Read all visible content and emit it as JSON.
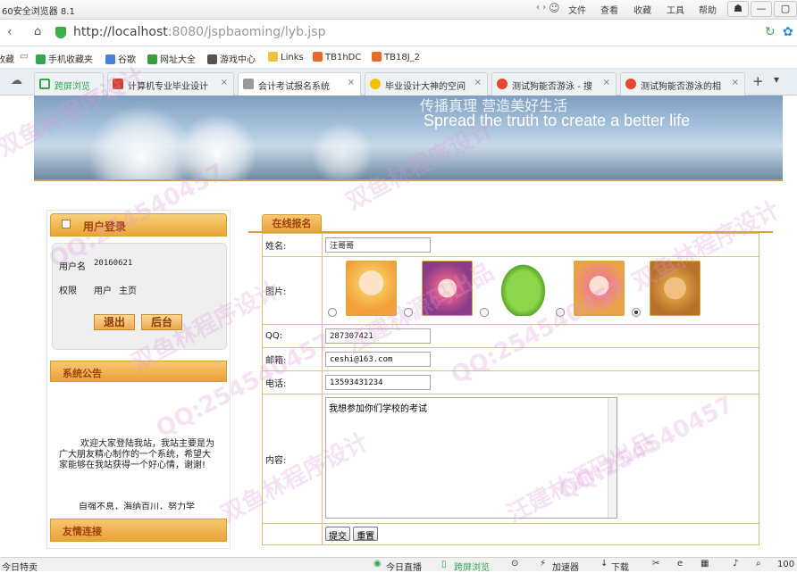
{
  "browser": {
    "title": "60安全浏览器 8.1",
    "menus": [
      "文件",
      "查看",
      "收藏",
      "工具",
      "帮助"
    ],
    "url_host": "http://localhost",
    "url_path": ":8080/jspbaoming/lyb.jsp",
    "bookmarks": [
      "收藏",
      "手机收藏夹",
      "谷歌",
      "网址大全",
      "游戏中心",
      "Links",
      "TB1hDC",
      "TB18J_2"
    ],
    "tabs": [
      {
        "label": "跨屏浏览",
        "icon_color": "#2fa84f"
      },
      {
        "label": "计算机专业毕业设计",
        "icon_color": "#d23f2b"
      },
      {
        "label": "会计考试报名系统",
        "icon_color": "#777777",
        "active": true
      },
      {
        "label": "毕业设计大神的空间",
        "icon_color": "#f2c200"
      },
      {
        "label": "测试狗能否游泳 - 搜",
        "icon_color": "#e14a2a"
      },
      {
        "label": "测试狗能否游泳的相",
        "icon_color": "#e14a2a"
      }
    ],
    "status": {
      "left": "今日特卖",
      "items": [
        "今日直播",
        "跨屏浏览",
        "加速器",
        "下载"
      ],
      "zoom": "100"
    }
  },
  "banner": {
    "slogan_cn": "传播真理 营造美好生活",
    "slogan_en": "Spread the truth to create a better life"
  },
  "login": {
    "title": "用户登录",
    "username_label": "用户名",
    "username_value": "20160621",
    "role_label": "权限",
    "role_value": "用户",
    "home_link": "主页",
    "logout_button": "退出",
    "back_button": "后台"
  },
  "announcement": {
    "title": "系统公告",
    "text": "欢迎大家登陆我站，我站主要是为广大朋友精心制作的一个系统，希望大家能够在我站获得一个好心情，谢谢!",
    "text2": "自强不息，海纳百川，努力学"
  },
  "links": {
    "title": "友情连接"
  },
  "form": {
    "tab_label": "在线报名",
    "fields": {
      "name_label": "姓名:",
      "name_value": "汪哥哥",
      "image_label": "图片:",
      "qq_label": "QQ:",
      "qq_value": "287307421",
      "email_label": "邮箱:",
      "email_value": "ceshi@163.com",
      "phone_label": "电话:",
      "phone_value": "13593431234",
      "content_label": "内容:",
      "content_value": "我想参加你们学校的考试"
    },
    "avatars": [
      {
        "name": "avatar-boy",
        "selected": false,
        "color": "#f5c55a"
      },
      {
        "name": "avatar-girl",
        "selected": false,
        "color": "#e05c8a"
      },
      {
        "name": "avatar-frog",
        "selected": false,
        "color": "#7cc43c"
      },
      {
        "name": "avatar-doll",
        "selected": false,
        "color": "#f09080"
      },
      {
        "name": "avatar-bear",
        "selected": true,
        "color": "#d89a40"
      }
    ],
    "submit_button": "提交",
    "reset_button": "重置"
  },
  "watermarks": [
    "双鱼林程序设计",
    "QQ:254540457",
    "汪建林源码出品"
  ]
}
